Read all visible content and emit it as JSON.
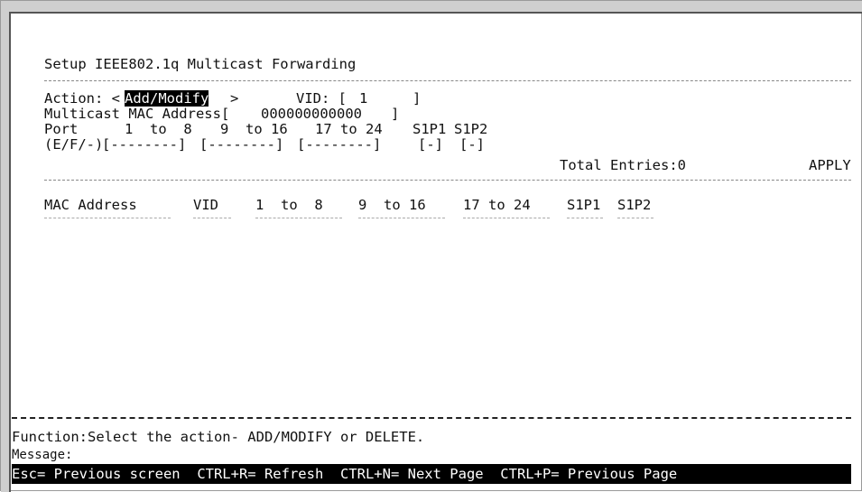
{
  "title": "Setup IEEE802.1q Multicast Forwarding",
  "form": {
    "action_label": "Action: <",
    "action_value": "Add/Modify",
    "action_close": ">",
    "vid_label": "VID: [",
    "vid_value": "1",
    "vid_close": "]",
    "mac_label": "Multicast MAC Address[",
    "mac_value": "000000000000",
    "mac_close": "]",
    "port_label": "Port",
    "port_group1": "1  to  8",
    "port_group2": "9  to 16",
    "port_group3": "17 to 24",
    "port_s1p1": "S1P1",
    "port_s1p2": "S1P2",
    "efd_label": "(E/F/-)",
    "efd_group1": "[--------]",
    "efd_group2": "[--------]",
    "efd_group3": "[--------]",
    "efd_s1p1": "[-]",
    "efd_s1p2": "[-]",
    "total_entries": "Total Entries:0",
    "apply": "APPLY"
  },
  "table": {
    "headers": [
      "MAC Address",
      "VID",
      "1  to  8",
      "9  to 16",
      "17 to 24",
      "S1P1",
      "S1P2"
    ]
  },
  "function_text": "Function:Select the action- ADD/MODIFY or DELETE.",
  "message_label": "Message:",
  "footer": {
    "esc": "Esc= Previous screen",
    "refresh": "CTRL+R= Refresh",
    "next": "CTRL+N= Next Page",
    "prev": "CTRL+P= Previous Page"
  }
}
